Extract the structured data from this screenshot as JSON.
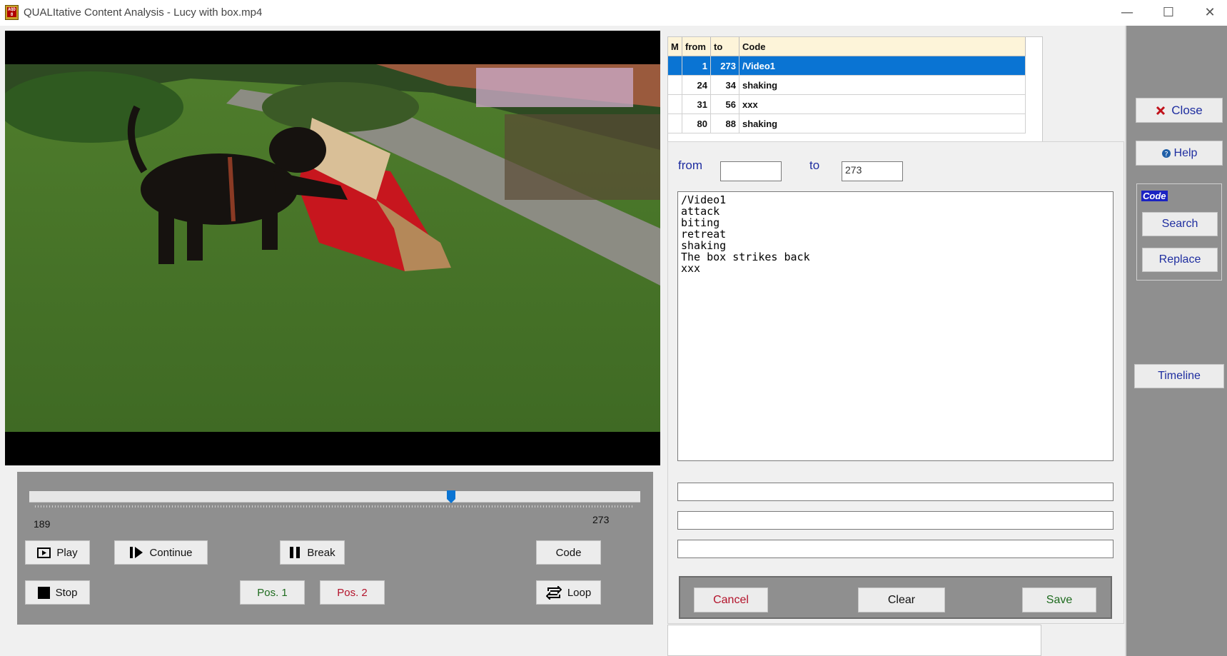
{
  "window": {
    "title": "QUALItative Content Analysis - Lucy with box.mp4",
    "icon_text": "AQD 8",
    "controls": {
      "minimize": "—",
      "maximize": "☐",
      "close": "✕"
    }
  },
  "video": {
    "file": "Lucy with box.mp4"
  },
  "player": {
    "slider_start_label": "189",
    "slider_end_label": "273",
    "slider_position_fraction": 0.69,
    "buttons": {
      "play": "Play",
      "continue": "Continue",
      "break": "Break",
      "code": "Code",
      "stop": "Stop",
      "pos1": "Pos. 1",
      "pos2": "Pos. 2",
      "loop": "Loop"
    },
    "colors": {
      "pos1": "#1e6b1e",
      "pos2": "#b3122a"
    }
  },
  "codings_table": {
    "columns": [
      "M",
      "from",
      "to",
      "Code"
    ],
    "rows": [
      {
        "m": "",
        "from": "1",
        "to": "273",
        "code": "/Video1",
        "selected": true
      },
      {
        "m": "",
        "from": "24",
        "to": "34",
        "code": "shaking",
        "selected": false
      },
      {
        "m": "",
        "from": "31",
        "to": "56",
        "code": "xxx",
        "selected": false
      },
      {
        "m": "",
        "from": "80",
        "to": "88",
        "code": "shaking",
        "selected": false
      }
    ]
  },
  "coding_form": {
    "from_label": "from",
    "to_label": "to",
    "from_value": "",
    "to_value": "273",
    "code_list": [
      "/Video1",
      "attack",
      "biting",
      "retreat",
      "shaking",
      "The box strikes back",
      "xxx"
    ],
    "extra_fields": [
      "",
      "",
      ""
    ],
    "buttons": {
      "cancel": "Cancel",
      "clear": "Clear",
      "save": "Save"
    },
    "colors": {
      "cancel": "#b3122a",
      "save": "#1e6b1e",
      "label": "#1f2ea0"
    }
  },
  "sidebar": {
    "close": "Close",
    "help": "Help",
    "code_group_label": "Code",
    "search": "Search",
    "replace": "Replace",
    "timeline": "Timeline",
    "colors": {
      "text": "#1f2ea0",
      "close_icon": "#c0111a"
    }
  }
}
